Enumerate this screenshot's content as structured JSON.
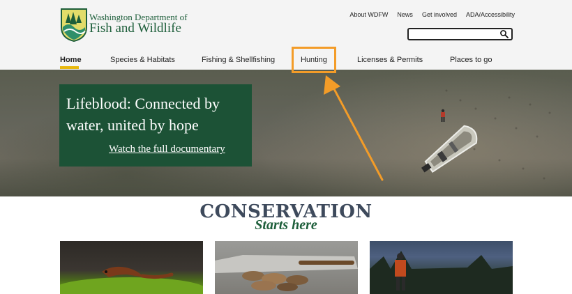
{
  "brand": {
    "name_line1": "Washington Department of",
    "name_line2": "Fish and Wildlife"
  },
  "utility_nav": [
    "About WDFW",
    "News",
    "Get involved",
    "ADA/Accessibility"
  ],
  "search": {
    "placeholder": "",
    "value": ""
  },
  "main_nav": {
    "items": [
      "Home",
      "Species & Habitats",
      "Fishing & Shellfishing",
      "Hunting",
      "Licenses & Permits",
      "Places to go"
    ],
    "active": "Home",
    "highlighted": "Hunting"
  },
  "hero": {
    "title": "Lifeblood: Connected by water, united by hope",
    "link": "Watch the full documentary"
  },
  "conservation": {
    "title": "CONSERVATION",
    "subtitle": "Starts here"
  },
  "cards": [
    {
      "icon": "newt-photo"
    },
    {
      "icon": "shellfish-photo"
    },
    {
      "icon": "hunter-photo"
    }
  ],
  "colors": {
    "brand_green": "#1d5e3a",
    "active_underline": "#e8b80e",
    "highlight_orange": "#f39c28",
    "conservation_title": "#3e4a5c"
  }
}
